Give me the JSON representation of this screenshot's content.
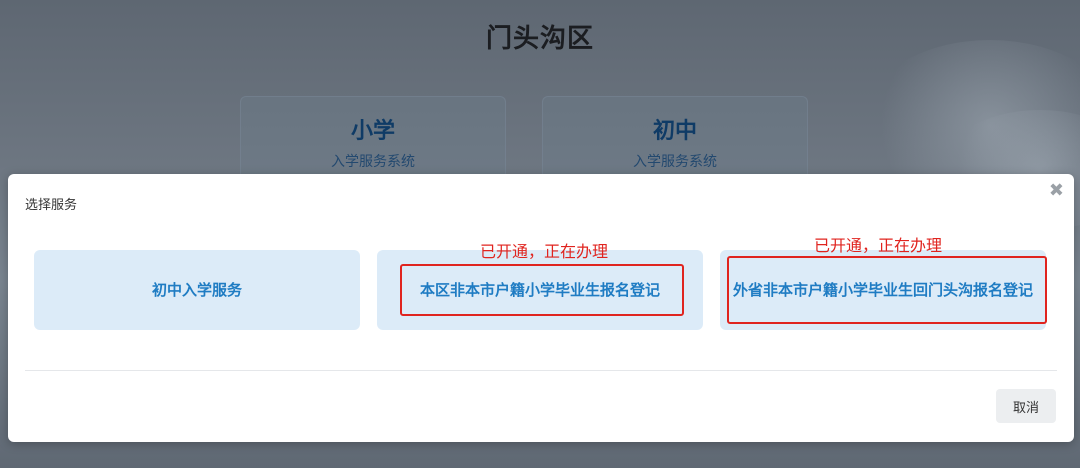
{
  "background": {
    "district_title": "门头沟区",
    "cards": [
      {
        "title": "小学",
        "subtitle": "入学服务系统"
      },
      {
        "title": "初中",
        "subtitle": "入学服务系统"
      }
    ]
  },
  "modal": {
    "title": "选择服务",
    "close_icon": "close-icon",
    "options": [
      {
        "label": "初中入学服务"
      },
      {
        "label": "本区非本市户籍小学毕业生报名登记",
        "note": "已开通，正在办理"
      },
      {
        "label": "外省非本市户籍小学毕业生回门头沟报名登记",
        "note": "已开通，正在办理"
      }
    ],
    "cancel_label": "取消"
  },
  "colors": {
    "option_bg": "#dcebf8",
    "option_text": "#1f7cc3",
    "annotation": "#e0241f"
  }
}
